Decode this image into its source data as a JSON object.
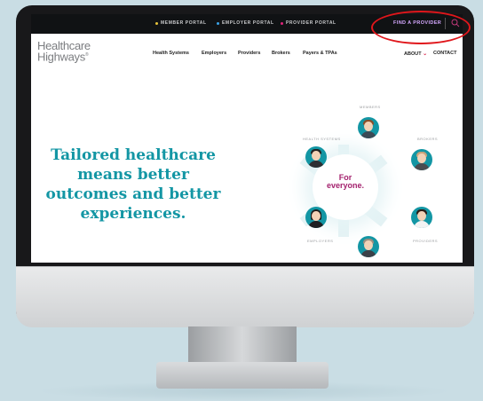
{
  "topbar": {
    "portals": [
      {
        "label": "MEMBER PORTAL",
        "dot_color": "#e7c33b"
      },
      {
        "label": "EMPLOYER PORTAL",
        "dot_color": "#3ba3e7"
      },
      {
        "label": "PROVIDER PORTAL",
        "dot_color": "#e0237a"
      }
    ],
    "find_provider": "FIND A PROVIDER"
  },
  "logo": {
    "line1": "Healthcare",
    "line2": "Highways",
    "mark": "®"
  },
  "nav": {
    "items": [
      "Health Systems",
      "Employers",
      "Providers",
      "Brokers",
      "Payers & TPAs"
    ],
    "about": "ABOUT",
    "contact": "CONTACT"
  },
  "hero": {
    "headline": "Tailored healthcare means better outcomes and better experiences."
  },
  "hub": {
    "line1": "For",
    "line2": "everyone.",
    "roles": {
      "members": "MEMBERS",
      "health_systems": "HEALTH SYSTEMS",
      "brokers": "BROKERS",
      "employers": "EMPLOYERS",
      "providers": "PROVIDERS"
    }
  },
  "colors": {
    "accent": "#1396a4",
    "brand_purple": "#a4226e",
    "highlight": "#e0161b"
  }
}
